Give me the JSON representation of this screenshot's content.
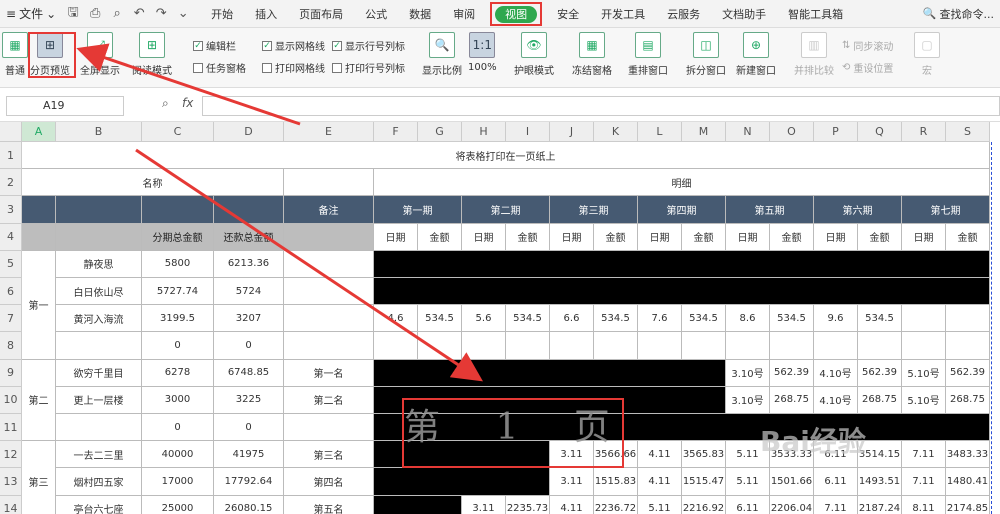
{
  "menu": {
    "file_label": "文件",
    "tabs": [
      "开始",
      "插入",
      "页面布局",
      "公式",
      "数据",
      "审阅",
      "视图",
      "安全",
      "开发工具",
      "云服务",
      "文档助手",
      "智能工具箱"
    ],
    "active_tab": "视图",
    "search_label": "查找命令..."
  },
  "ribbon": {
    "normal": "普通",
    "page_break_preview": "分页预览",
    "fullscreen": "全屏显示",
    "reading_mode": "阅读模式",
    "edit_bar": "编辑栏",
    "task_pane": "任务窗格",
    "show_gridlines": "显示网格线",
    "print_gridlines": "打印网格线",
    "show_row_col_headers": "显示行号列标",
    "print_row_col_headers": "打印行号列标",
    "zoom": "显示比例",
    "zoom_100": "100%",
    "eye_protect": "护眼模式",
    "freeze": "冻结窗格",
    "rearrange": "重排窗口",
    "split": "拆分窗口",
    "new_window": "新建窗口",
    "side_by_side": "并排比较",
    "sync_scroll": "同步滚动",
    "reset_position": "重设位置",
    "macro": "宏"
  },
  "formula_bar": {
    "cell_ref": "A19",
    "fx": "fx"
  },
  "columns": [
    "A",
    "B",
    "C",
    "D",
    "E",
    "F",
    "G",
    "H",
    "I",
    "J",
    "K",
    "L",
    "M",
    "N",
    "O",
    "P",
    "Q",
    "R",
    "S"
  ],
  "rows": [
    "1",
    "2",
    "3",
    "4",
    "5",
    "6",
    "7",
    "8",
    "9",
    "10",
    "11",
    "12",
    "13",
    "14"
  ],
  "sheet": {
    "title": "将表格打印在一页纸上",
    "name_header": "名称",
    "detail_header": "明细",
    "remark_header": "备注",
    "periods": [
      "第一期",
      "第二期",
      "第三期",
      "第四期",
      "第五期",
      "第六期",
      "第七期"
    ],
    "date_label": "日期",
    "amount_label": "金额",
    "total_label": "分期总金额",
    "repay_label": "还款总金额",
    "group1": "第一",
    "group2": "第二",
    "group3": "第三",
    "items": [
      {
        "name": "静夜思",
        "total": "5800",
        "repay": "6213.36"
      },
      {
        "name": "白日依山尽",
        "total": "5727.74",
        "repay": "5724"
      },
      {
        "name": "黄河入海流",
        "total": "3199.5",
        "repay": "3207"
      },
      {
        "name": "",
        "total": "0",
        "repay": "0"
      },
      {
        "name": "欲穷千里目",
        "total": "6278",
        "repay": "6748.85",
        "remark": "第一名"
      },
      {
        "name": "更上一层楼",
        "total": "3000",
        "repay": "3225",
        "remark": "第二名"
      },
      {
        "name": "",
        "total": "0",
        "repay": "0"
      },
      {
        "name": "一去二三里",
        "total": "40000",
        "repay": "41975",
        "remark": "第三名"
      },
      {
        "name": "烟村四五家",
        "total": "17000",
        "repay": "17792.64",
        "remark": "第四名"
      },
      {
        "name": "亭台六七座",
        "total": "25000",
        "repay": "26080.15",
        "remark": "第五名"
      }
    ],
    "row7": [
      "4.6",
      "534.5",
      "5.6",
      "534.5",
      "6.6",
      "534.5",
      "7.6",
      "534.5",
      "8.6",
      "534.5",
      "9.6",
      "534.5"
    ],
    "row9": [
      "3.10号",
      "562.39",
      "4.10号",
      "562.39",
      "5.10号",
      "562.39"
    ],
    "row10": [
      "3.10号",
      "268.75",
      "4.10号",
      "268.75",
      "5.10号",
      "268.75"
    ],
    "row12": [
      "3.11",
      "3566.66",
      "4.11",
      "3565.83",
      "5.11",
      "3533.33",
      "6.11",
      "3514.15",
      "7.11",
      "3483.33"
    ],
    "row13": [
      "3.11",
      "1515.83",
      "4.11",
      "1515.47",
      "5.11",
      "1501.66",
      "6.11",
      "1493.51",
      "7.11",
      "1480.41"
    ],
    "row14": [
      "3.11",
      "2235.73",
      "4.11",
      "2236.72",
      "5.11",
      "2216.92",
      "6.11",
      "2206.04",
      "7.11",
      "2187.24",
      "8.11",
      "2174.85"
    ]
  },
  "watermark": "第 1 页"
}
